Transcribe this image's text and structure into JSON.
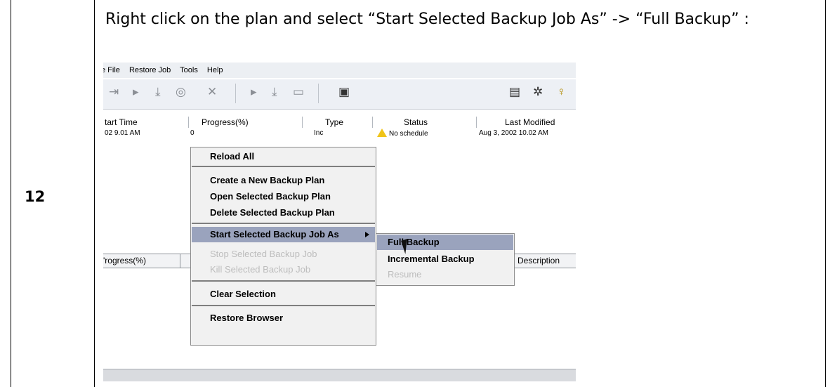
{
  "step": {
    "number": "12",
    "instruction": "Right click on the plan and select “Start Selected Backup Job As” -> “Full Backup” :"
  },
  "screenshot": {
    "menubar": [
      "e File",
      "Restore Job",
      "Tools",
      "Help"
    ],
    "toolbar_icons": [
      "step-back-icon",
      "play-small-icon",
      "download-icon",
      "clock-icon",
      "cancel-icon",
      "run-icon",
      "download-icon",
      "doc-icon",
      "graph-icon",
      "log-icon",
      "tools-icon",
      "help-icon"
    ],
    "grid_columns": [
      "tart Time",
      "Progress(%)",
      "Type",
      "Status",
      "Last Modified"
    ],
    "grid_row": {
      "start_time": "02 9.01 AM",
      "progress": "0",
      "type": "Inc",
      "status": "No schedule",
      "last_modified": "Aug 3, 2002 10.02 AM"
    },
    "lower_columns": [
      "'rogress(%)",
      "Description"
    ],
    "context_menu": {
      "items": [
        {
          "label": "Reload All",
          "state": "enabled"
        },
        {
          "label": "Create a New Backup Plan",
          "state": "enabled"
        },
        {
          "label": "Open Selected Backup Plan",
          "state": "enabled"
        },
        {
          "label": "Delete Selected Backup Plan",
          "state": "enabled"
        },
        {
          "label": "Start Selected Backup Job As",
          "state": "highlighted"
        },
        {
          "label": "Stop Selected Backup Job",
          "state": "disabled"
        },
        {
          "label": "Kill Selected Backup Job",
          "state": "disabled"
        },
        {
          "label": "Clear Selection",
          "state": "enabled"
        },
        {
          "label": "Restore Browser",
          "state": "enabled"
        }
      ]
    },
    "submenu": {
      "items": [
        {
          "label": "Full Backup",
          "state": "highlighted"
        },
        {
          "label": "Incremental Backup",
          "state": "enabled"
        },
        {
          "label": "Resume",
          "state": "disabled"
        }
      ]
    },
    "colors": {
      "menu_highlight": "#9aa3bd",
      "menu_background": "#f1f1f1",
      "disabled_text": "#bdbdbd",
      "warning": "#f0c419"
    }
  }
}
